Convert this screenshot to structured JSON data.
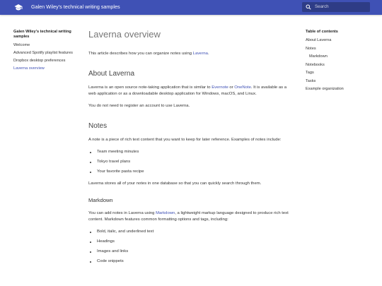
{
  "header": {
    "site_title": "Galen Wiley's technical writing samples",
    "logo_icon": "graduation-cap-icon",
    "search_placeholder": "Search",
    "color": "#3f51b5"
  },
  "nav": {
    "title": "Galen Wiley's technical writing samples",
    "items": [
      {
        "label": "Welcome"
      },
      {
        "label": "Advanced Spotify playlist features"
      },
      {
        "label": "Dropbox desktop preferences"
      },
      {
        "label": "Laverna overview",
        "active": true
      }
    ]
  },
  "main": {
    "title": "Laverna overview",
    "intro": {
      "before": "This article describes how you can organize notes using ",
      "link": "Laverna",
      "after": "."
    },
    "about": {
      "heading": "About Laverna",
      "p1_a": "Laverna is an open source note-taking application that is similar to ",
      "p1_link1": "Evernote",
      "p1_b": " or ",
      "p1_link2": "OneNote",
      "p1_c": ". It is available as a web application or as a downloadable desktop application for Windows, macOS, and Linux.",
      "p2": "You do not need to register an account to use Laverna."
    },
    "notes": {
      "heading": "Notes",
      "p1": "A note is a piece of rich text content that you want to keep for later reference. Examples of notes include:",
      "examples": [
        "Team meeting minutes",
        "Tokyo travel plans",
        "Your favorite pasta recipe"
      ],
      "p2": "Laverna stores all of your notes in one database so that you can quickly search through them."
    },
    "markdown": {
      "heading": "Markdown",
      "p1_a": "You can add notes in Laverna using ",
      "p1_link": "Markdown",
      "p1_b": ", a lightweight markup language designed to produce rich text content. Markdown features common formatting options and tags, including:",
      "features": [
        "Bold, italic, and underlined text",
        "Headings",
        "Images and links",
        "Code snippets"
      ]
    }
  },
  "toc": {
    "title": "Table of contents",
    "items": [
      {
        "label": "About Laverna"
      },
      {
        "label": "Notes"
      },
      {
        "label": "Markdown",
        "sub": true
      },
      {
        "label": "Notebooks"
      },
      {
        "label": "Tags"
      },
      {
        "label": "Tasks"
      },
      {
        "label": "Example organization"
      }
    ]
  }
}
